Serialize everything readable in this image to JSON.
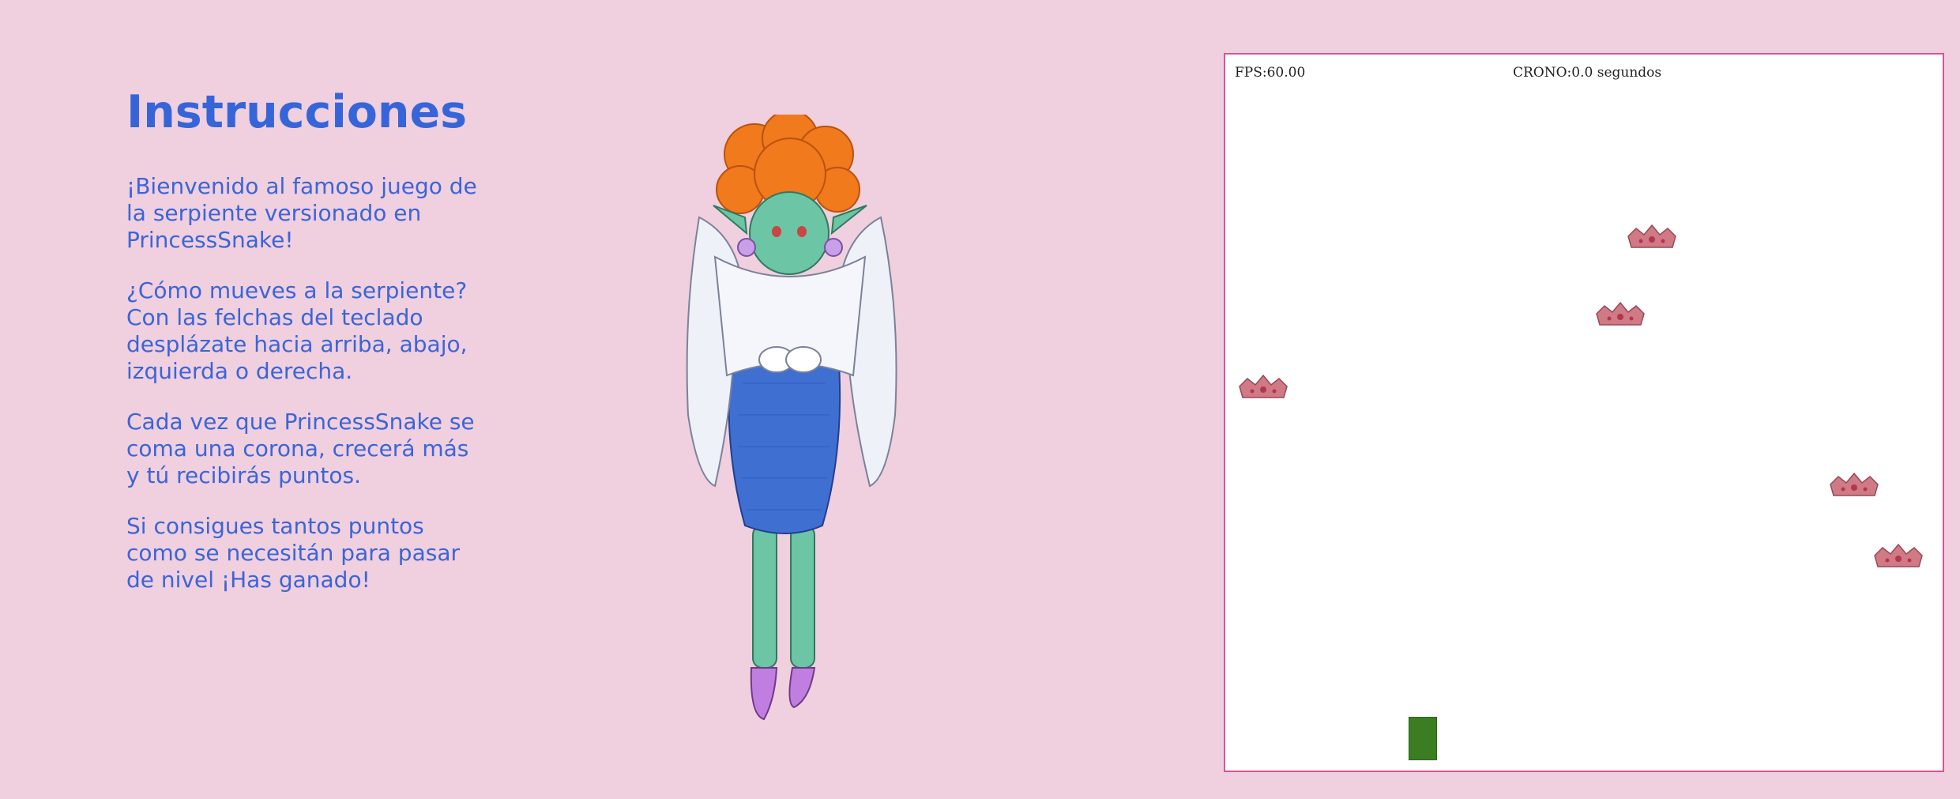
{
  "instructions": {
    "title": "Instrucciones",
    "paragraphs": [
      "¡Bienvenido al famoso juego de la serpiente versionado en PrincessSnake!",
      "¿Cómo mueves a la serpiente? Con las felchas del teclado desplázate hacia arriba, abajo, izquierda o derecha.",
      "Cada vez que PrincessSnake se coma una corona, crecerá más y tú recibirás puntos.",
      "Si consigues tantos puntos como se necesitán para pasar de nivel ¡Has ganado!"
    ]
  },
  "game": {
    "fps": "FPS:60.00",
    "crono": "CRONO:0.0 segundos"
  },
  "colors": {
    "background": "#f0cfdf",
    "text": "#3a65d8",
    "game_border": "#d9529e",
    "snake": "#3a7d22",
    "crown": "#d07a86"
  }
}
